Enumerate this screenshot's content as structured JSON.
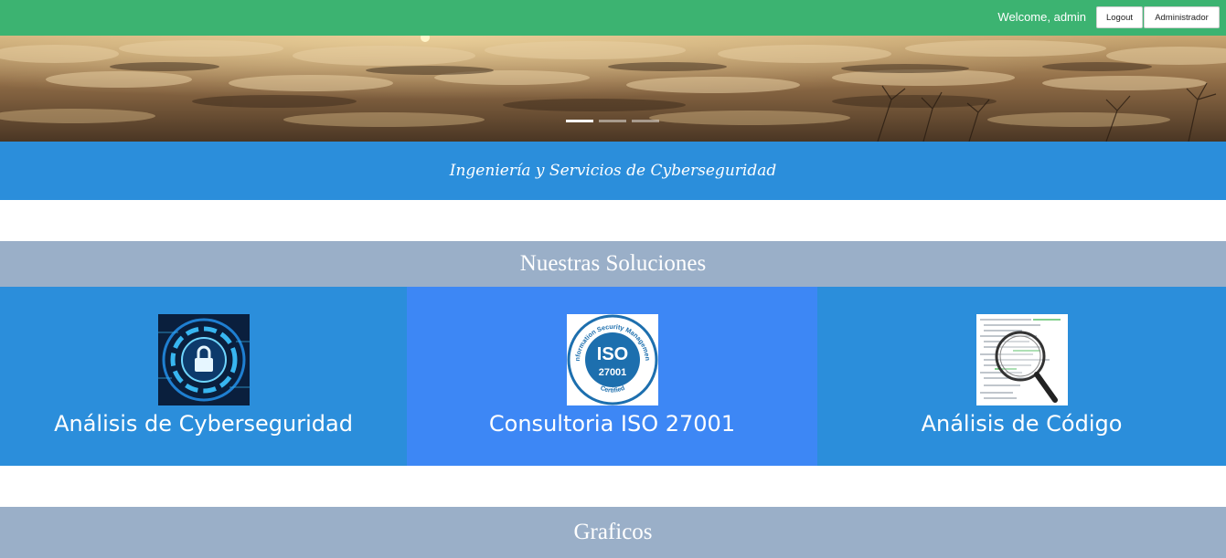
{
  "topbar": {
    "welcome": "Welcome, admin",
    "logout_label": "Logout",
    "admin_label": "Administrador",
    "color": "#3cb371"
  },
  "hero": {
    "slides": 3,
    "active_slide": 1
  },
  "tagline": "Ingeniería y Servicios de Cyberseguridad",
  "solutions": {
    "title": "Nuestras Soluciones",
    "items": [
      {
        "label": "Análisis de Cyberseguridad",
        "icon": "padlock-circuit-icon"
      },
      {
        "label": "Consultoria ISO 27001",
        "icon": "iso-27001-certified-badge",
        "badge_arc": "Information Security Management",
        "badge_iso": "ISO",
        "badge_number": "27001",
        "badge_certified": "Certified"
      },
      {
        "label": "Análisis de Código",
        "icon": "magnifier-code-icon"
      }
    ]
  },
  "charts_section": {
    "title": "Graficos"
  },
  "colors": {
    "band_blue": "#2b8edb",
    "tile_highlight": "#3d87f5",
    "section_grey": "#9aafc8"
  }
}
